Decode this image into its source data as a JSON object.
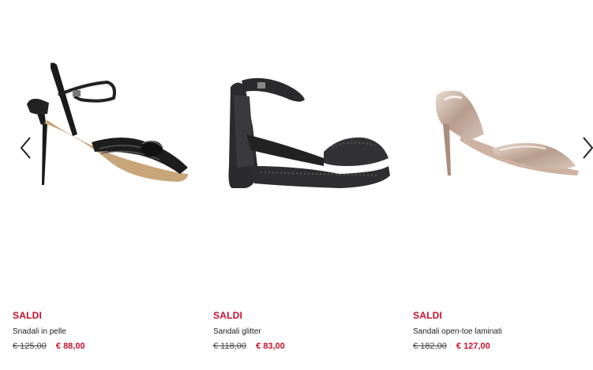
{
  "carousel": {
    "prev_icon": "chevron-left-icon",
    "next_icon": "chevron-right-icon",
    "products": [
      {
        "badge": "SALDI",
        "name": "Snadali in pelle",
        "old_price": "€ 125,00",
        "new_price": "€ 88,00"
      },
      {
        "badge": "SALDI",
        "name": "Sandali glitter",
        "old_price": "€ 118,00",
        "new_price": "€ 83,00"
      },
      {
        "badge": "SALDI",
        "name": "Sandali open-toe laminati",
        "old_price": "€ 182,00",
        "new_price": "€ 127,00"
      }
    ]
  },
  "colors": {
    "sale_red": "#c8102e",
    "text_dark": "#222222"
  }
}
